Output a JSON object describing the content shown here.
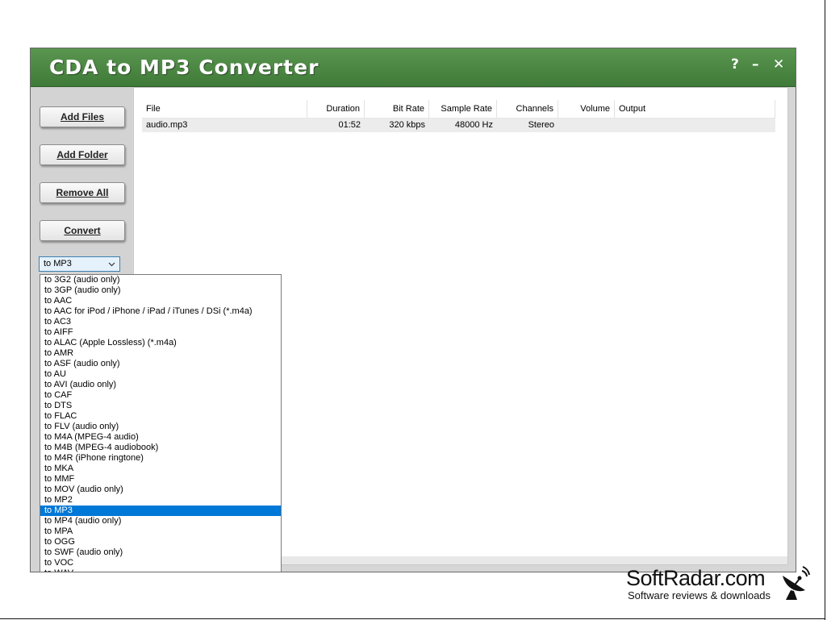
{
  "window": {
    "title": "CDA to MP3 Converter",
    "controls": {
      "help": "?",
      "minimize": "–",
      "close": "✕"
    }
  },
  "sidebar": {
    "buttons": {
      "add_files": "Add Files",
      "add_folder": "Add Folder",
      "remove_all": "Remove All",
      "convert": "Convert"
    },
    "format_select": {
      "value": "to MP3"
    }
  },
  "table": {
    "columns": {
      "file": "File",
      "duration": "Duration",
      "bitrate": "Bit Rate",
      "sample_rate": "Sample Rate",
      "channels": "Channels",
      "volume": "Volume",
      "output": "Output"
    },
    "rows": [
      {
        "file": "audio.mp3",
        "duration": "01:52",
        "bitrate": "320 kbps",
        "sample_rate": "48000 Hz",
        "channels": "Stereo",
        "volume": "",
        "output": ""
      }
    ]
  },
  "dropdown": {
    "options": [
      "to 3G2 (audio only)",
      "to 3GP (audio only)",
      "to AAC",
      "to AAC for iPod / iPhone / iPad / iTunes / DSi (*.m4a)",
      "to AC3",
      "to AIFF",
      "to ALAC (Apple Lossless) (*.m4a)",
      "to AMR",
      "to ASF (audio only)",
      "to AU",
      "to AVI (audio only)",
      "to CAF",
      "to DTS",
      "to FLAC",
      "to FLV (audio only)",
      "to M4A (MPEG-4 audio)",
      "to M4B (MPEG-4 audiobook)",
      "to M4R (iPhone ringtone)",
      "to MKA",
      "to MMF",
      "to MOV (audio only)",
      "to MP2",
      "to MP3",
      "to MP4 (audio only)",
      "to MPA",
      "to OGG",
      "to SWF (audio only)",
      "to VOC",
      "to WAV"
    ],
    "selected": "to MP3"
  },
  "watermark": {
    "brand": "SoftRadar.com",
    "tagline": "Software reviews & downloads",
    "icon": "satellite-dish-icon"
  },
  "colors": {
    "title_bar": "#4a8a43",
    "selection": "#0078d7",
    "sidebar": "#d3d3d3"
  }
}
